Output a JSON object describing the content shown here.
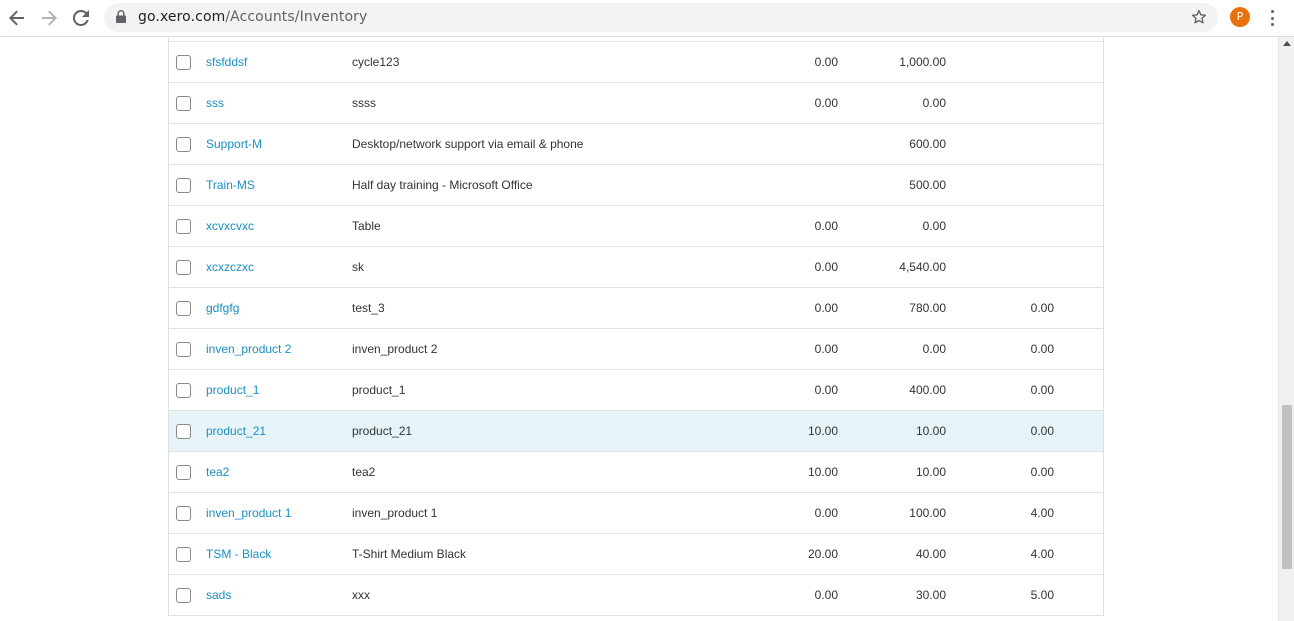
{
  "browser": {
    "url_host": "go.xero.com",
    "url_path": "/Accounts/Inventory",
    "profile_initial": "P",
    "icons": [
      "back-arrow-icon",
      "forward-arrow-icon",
      "reload-icon",
      "lock-icon",
      "star-icon",
      "menu-icon"
    ]
  },
  "colors": {
    "link": "#1a8fbf",
    "highlight_row": "#e6f4f8",
    "avatar": "#e8710a"
  },
  "inventory": {
    "rows": [
      {
        "code": "sfsfddsf",
        "description": "cycle123",
        "col1": "0.00",
        "col2": "1,000.00",
        "col3": ""
      },
      {
        "code": "sss",
        "description": "ssss",
        "col1": "0.00",
        "col2": "0.00",
        "col3": ""
      },
      {
        "code": "Support-M",
        "description": "Desktop/network support via email & phone",
        "col1": "",
        "col2": "600.00",
        "col3": ""
      },
      {
        "code": "Train-MS",
        "description": "Half day training - Microsoft Office",
        "col1": "",
        "col2": "500.00",
        "col3": ""
      },
      {
        "code": "xcvxcvxc",
        "description": "Table",
        "col1": "0.00",
        "col2": "0.00",
        "col3": ""
      },
      {
        "code": "xcxzczxc",
        "description": "sk",
        "col1": "0.00",
        "col2": "4,540.00",
        "col3": ""
      },
      {
        "code": "gdfgfg",
        "description": "test_3",
        "col1": "0.00",
        "col2": "780.00",
        "col3": "0.00"
      },
      {
        "code": "inven_product 2",
        "description": "inven_product 2",
        "col1": "0.00",
        "col2": "0.00",
        "col3": "0.00"
      },
      {
        "code": "product_1",
        "description": "product_1",
        "col1": "0.00",
        "col2": "400.00",
        "col3": "0.00"
      },
      {
        "code": "product_21",
        "description": "product_21",
        "col1": "10.00",
        "col2": "10.00",
        "col3": "0.00",
        "highlighted": true
      },
      {
        "code": "tea2",
        "description": "tea2",
        "col1": "10.00",
        "col2": "10.00",
        "col3": "0.00"
      },
      {
        "code": "inven_product 1",
        "description": "inven_product 1",
        "col1": "0.00",
        "col2": "100.00",
        "col3": "4.00"
      },
      {
        "code": "TSM - Black",
        "description": "T-Shirt Medium Black",
        "col1": "20.00",
        "col2": "40.00",
        "col3": "4.00"
      },
      {
        "code": "sads",
        "description": "xxx",
        "col1": "0.00",
        "col2": "30.00",
        "col3": "5.00"
      }
    ]
  }
}
